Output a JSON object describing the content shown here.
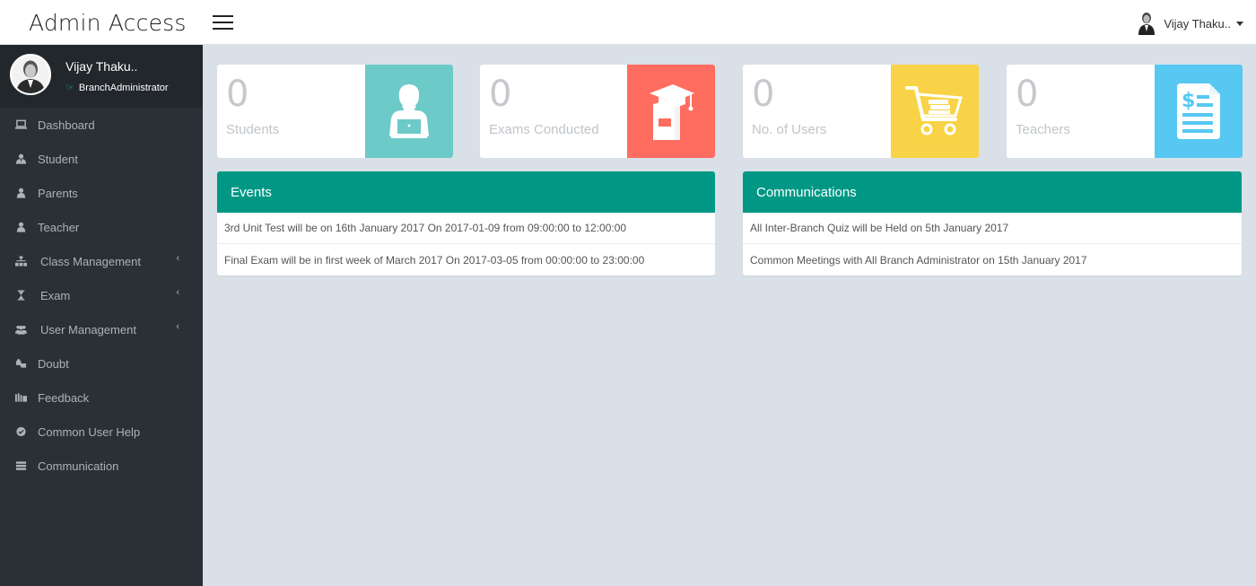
{
  "header": {
    "brand": "Admin Access",
    "user_name": "Vijay Thaku.."
  },
  "sidebar": {
    "profile": {
      "name": "Vijay Thaku..",
      "role": "BranchAdministrator"
    },
    "items": [
      {
        "label": "Dashboard",
        "icon": "laptop-icon"
      },
      {
        "label": "Student",
        "icon": "user-tie-icon"
      },
      {
        "label": "Parents",
        "icon": "user-icon"
      },
      {
        "label": "Teacher",
        "icon": "user-icon"
      },
      {
        "label": "Class Management",
        "icon": "sitemap-icon",
        "chevron": "‹"
      },
      {
        "label": "Exam",
        "icon": "hourglass-icon",
        "chevron": "‹"
      },
      {
        "label": "User Management",
        "icon": "users-icon",
        "chevron": "‹"
      },
      {
        "label": "Doubt",
        "icon": "puzzle-icon"
      },
      {
        "label": "Feedback",
        "icon": "books-icon"
      },
      {
        "label": "Common User Help",
        "icon": "check-circle-icon"
      },
      {
        "label": "Communication",
        "icon": "list-icon"
      }
    ]
  },
  "stats": [
    {
      "value": "0",
      "label": "Students",
      "color": "#6ccac9",
      "icon": "person-laptop-icon"
    },
    {
      "value": "0",
      "label": "Exams Conducted",
      "color": "#ff6c60",
      "icon": "graduation-book-icon"
    },
    {
      "value": "0",
      "label": "No. of Users",
      "color": "#f8d347",
      "icon": "shopping-cart-icon"
    },
    {
      "value": "0",
      "label": "Teachers",
      "color": "#57c8f2",
      "icon": "invoice-dollar-icon"
    }
  ],
  "events": {
    "title": "Events",
    "items": [
      "3rd Unit Test will be on 16th January 2017 On 2017-01-09 from 09:00:00 to 12:00:00",
      "Final Exam will be in first week of March 2017 On 2017-03-05 from 00:00:00 to 23:00:00"
    ]
  },
  "communications": {
    "title": "Communications",
    "items": [
      "All Inter-Branch Quiz will be Held on 5th January 2017",
      "Common Meetings with All Branch Administrator on 15th January 2017"
    ]
  },
  "colors": {
    "sidebar_bg": "#2a3036",
    "panel_header": "#009885",
    "accent_teal": "#1fb5ac"
  }
}
